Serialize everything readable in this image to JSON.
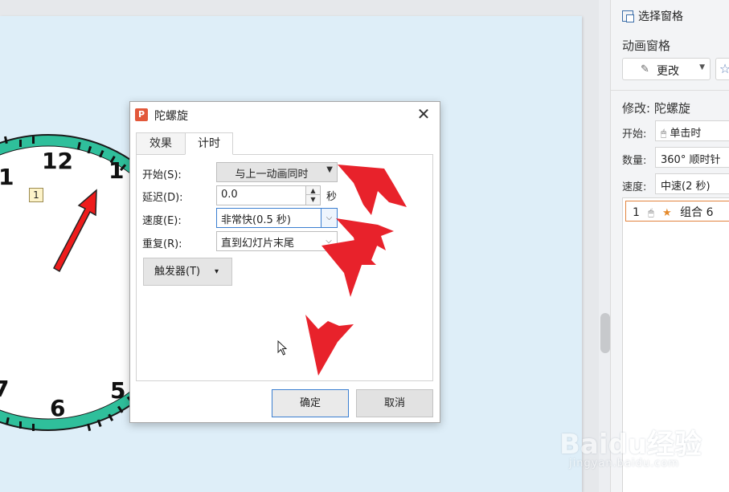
{
  "slide": {
    "clock_numbers": [
      "12",
      "1",
      "1",
      "5",
      "6",
      "7"
    ],
    "animation_tag": "1"
  },
  "right_panel": {
    "select_pane": "选择窗格",
    "title": "动画窗格",
    "modify_button": "更改",
    "modify_label": "修改: 陀螺旋",
    "start_label": "开始:",
    "start_value": "单击时",
    "quantity_label": "数量:",
    "quantity_value": "360° 顺时针",
    "speed_label": "速度:",
    "speed_value": "中速(2 秒)",
    "list_item": {
      "number": "1",
      "name": "组合 6"
    }
  },
  "dialog": {
    "title": "陀螺旋",
    "close": "✕",
    "tabs": [
      "效果",
      "计时"
    ],
    "active_tab": "计时",
    "start_label": "开始(S):",
    "start_value": "与上一动画同时",
    "delay_label": "延迟(D):",
    "delay_value": "0.0",
    "delay_unit": "秒",
    "speed_label": "速度(E):",
    "speed_value": "非常快(0.5 秒)",
    "repeat_label": "重复(R):",
    "repeat_value": "直到幻灯片末尾",
    "trigger_button": "触发器(T)",
    "ok_button": "确定",
    "cancel_button": "取消"
  },
  "watermark": {
    "logo": "Baidu经验",
    "url": "jingyan.baidu.com"
  },
  "colors": {
    "accent_red": "#e8222b",
    "clock_rim": "#2fbf9b",
    "slide_bg": "#deeef8",
    "focus_blue": "#3b7fd1",
    "logo_orange": "#e2583a"
  },
  "icons": [
    "select-pane-icon",
    "pencil-icon",
    "star-effect-icon",
    "mouse-icon",
    "spinner-arrow-icon",
    "dropdown-chevron-icon",
    "close-icon",
    "cursor-icon"
  ]
}
